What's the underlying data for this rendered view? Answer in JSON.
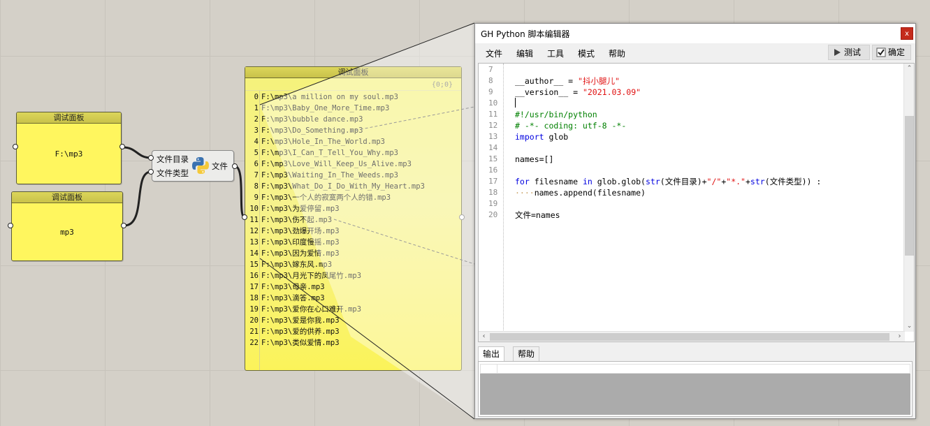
{
  "canvas": {
    "panel_small_1": {
      "title": "调试面板",
      "value": "F:\\mp3"
    },
    "panel_small_2": {
      "title": "调试面板",
      "value": "mp3"
    },
    "python_component": {
      "input_1": "文件目录",
      "input_2": "文件类型",
      "output": "文件"
    },
    "panel_big": {
      "title": "调试面板",
      "path_info": "{0;0}",
      "items": [
        "F:\\mp3\\a million on my soul.mp3",
        "F:\\mp3\\Baby_One_More_Time.mp3",
        "F:\\mp3\\bubble dance.mp3",
        "F:\\mp3\\Do_Something.mp3",
        "F:\\mp3\\Hole_In_The_World.mp3",
        "F:\\mp3\\I_Can_T_Tell_You_Why.mp3",
        "F:\\mp3\\Love_Will_Keep_Us_Alive.mp3",
        "F:\\mp3\\Waiting_In_The_Weeds.mp3",
        "F:\\mp3\\What_Do_I_Do_With_My_Heart.mp3",
        "F:\\mp3\\一个人的寂寞两个人的错.mp3",
        "F:\\mp3\\为爱停留.mp3",
        "F:\\mp3\\伤不起.mp3",
        "F:\\mp3\\劲爆开场.mp3",
        "F:\\mp3\\印度慢摇.mp3",
        "F:\\mp3\\因为爱情.mp3",
        "F:\\mp3\\嫁东风.mp3",
        "F:\\mp3\\月光下的凤尾竹.mp3",
        "F:\\mp3\\母亲.mp3",
        "F:\\mp3\\滴答.mp3",
        "F:\\mp3\\爱你在心口难开.mp3",
        "F:\\mp3\\爱是你我.mp3",
        "F:\\mp3\\爱的供养.mp3",
        "F:\\mp3\\类似爱情.mp3"
      ]
    }
  },
  "editor": {
    "title": "GH Python 脚本编辑器",
    "close_label": "x",
    "menu": [
      "文件",
      "编辑",
      "工具",
      "模式",
      "帮助"
    ],
    "test_label": "测试",
    "ok_label": "确定",
    "line_numbers": [
      "7",
      "8",
      "9",
      "10",
      "11",
      "12",
      "13",
      "14",
      "15",
      "16",
      "17",
      "18",
      "19",
      "20"
    ],
    "code": {
      "author_kw": "__author__",
      "author_eq": " = ",
      "author_val": "\"抖小腿儿\"",
      "version_kw": "__version__",
      "version_eq": " = ",
      "version_val": "\"2021.03.09\"",
      "shebang": "#!/usr/bin/python",
      "coding": "# -*- coding: utf-8 -*-",
      "import_kw": "import",
      "import_mod": " glob",
      "names_init": "names=[]",
      "for_kw": "for",
      "for_var": " filesname ",
      "in_kw": "in",
      "glob_call": " glob.glob(",
      "str_fn": "str",
      "arg1": "(文件目录)+",
      "slash": "\"/\"",
      "plus1": "+",
      "star": "\"*.\"",
      "plus2": "+",
      "str_fn2": "str",
      "arg2": "(文件类型)) :",
      "indent_dots": "····",
      "append_line": "names.append(filesname)",
      "output_line": "文件=names"
    },
    "tabs": [
      "输出",
      "帮助"
    ]
  }
}
